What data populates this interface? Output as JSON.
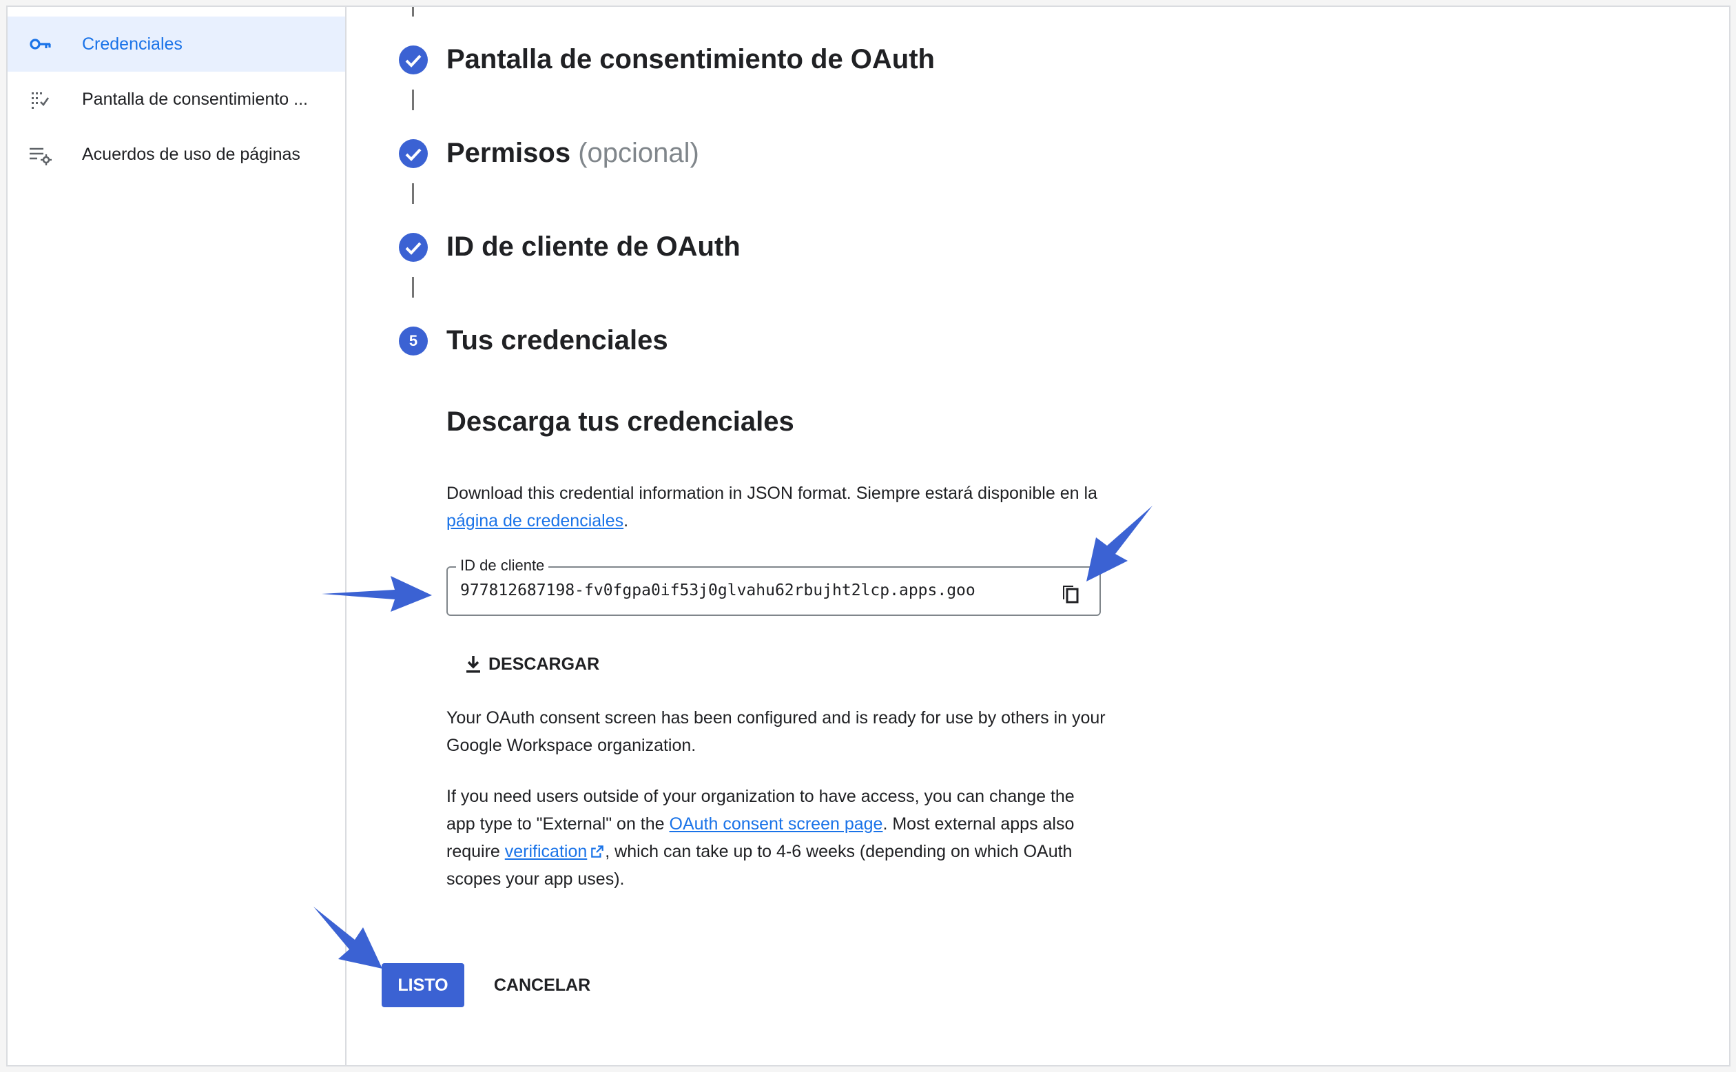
{
  "sidebar": {
    "items": [
      {
        "label": "Credenciales",
        "icon": "key-icon",
        "active": true
      },
      {
        "label": "Pantalla de consentimiento ...",
        "icon": "consent-screen-icon",
        "active": false
      },
      {
        "label": "Acuerdos de uso de páginas",
        "icon": "list-settings-icon",
        "active": false
      }
    ]
  },
  "stepper": {
    "steps": [
      {
        "title": "Pantalla de consentimiento de OAuth",
        "status": "complete"
      },
      {
        "title": "Permisos",
        "suffix": "(opcional)",
        "status": "complete"
      },
      {
        "title": "ID de cliente de OAuth",
        "status": "complete"
      },
      {
        "number": "5",
        "title": "Tus credenciales",
        "status": "current"
      }
    ]
  },
  "download": {
    "heading": "Descarga tus credenciales",
    "desc_text": "Download this credential information in JSON format. Siempre estará disponible en la ",
    "desc_link": "página de credenciales",
    "desc_end": ".",
    "client_id_label": "ID de cliente",
    "client_id_value": "977812687198-fv0fgpa0if53j0glvahu62rbujht2lcp.apps.goo",
    "download_label": "DESCARGAR"
  },
  "info": {
    "p1": "Your OAuth consent screen has been configured and is ready for use by others in your Google Workspace organization.",
    "p2_a": "If you need users outside of your organization to have access, you can change the app type to \"External\" on the ",
    "p2_link1": "OAuth consent screen page",
    "p2_b": ". Most external apps also require ",
    "p2_link2": "verification",
    "p2_c": ", which can take up to 4-6 weeks (depending on which OAuth scopes your app uses)."
  },
  "actions": {
    "done_label": "LISTO",
    "cancel_label": "CANCELAR"
  },
  "colors": {
    "accent": "#3b62d3",
    "link": "#1a73e8",
    "annotation_arrow": "#3b62d3",
    "active_nav_bg": "#e8f0fe"
  }
}
